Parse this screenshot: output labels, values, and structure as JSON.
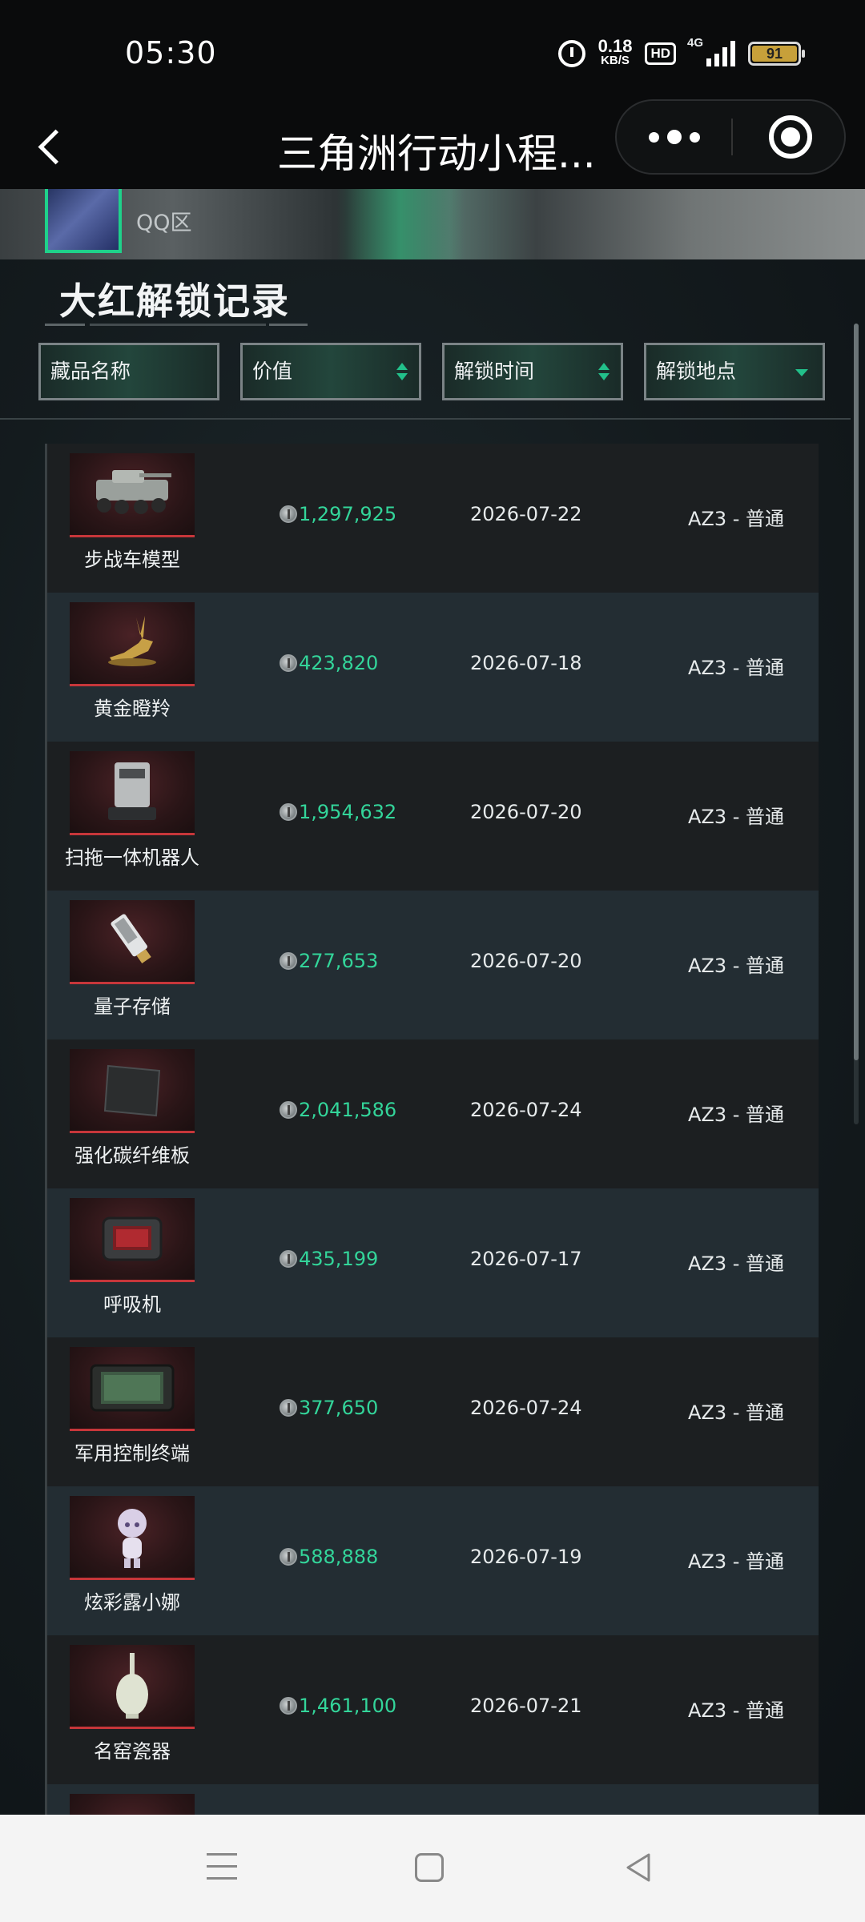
{
  "status_bar": {
    "time": "05:30",
    "speed_value": "0.18",
    "speed_unit": "KB/S",
    "hd": "HD",
    "network": "4G",
    "battery": "91"
  },
  "title_bar": {
    "title": "三角洲行动小程..."
  },
  "profile": {
    "zone": "QQ区"
  },
  "section": {
    "title": "大红解锁记录"
  },
  "filters": [
    {
      "label": "藏品名称"
    },
    {
      "label": "价值"
    },
    {
      "label": "解锁时间"
    },
    {
      "label": "解锁地点"
    }
  ],
  "records": [
    {
      "name": "步战车模型",
      "value": "1,297,925",
      "date": "2026-07-22",
      "place": "AZ3 - 普通",
      "icon": "armored-vehicle-icon"
    },
    {
      "name": "黄金瞪羚",
      "value": "423,820",
      "date": "2026-07-18",
      "place": "AZ3 - 普通",
      "icon": "golden-gazelle-icon"
    },
    {
      "name": "扫拖一体机器人",
      "value": "1,954,632",
      "date": "2026-07-20",
      "place": "AZ3 - 普通",
      "icon": "mop-robot-icon"
    },
    {
      "name": "量子存储",
      "value": "277,653",
      "date": "2026-07-20",
      "place": "AZ3 - 普通",
      "icon": "quantum-storage-icon"
    },
    {
      "name": "强化碳纤维板",
      "value": "2,041,586",
      "date": "2026-07-24",
      "place": "AZ3 - 普通",
      "icon": "carbon-fiber-plate-icon"
    },
    {
      "name": "呼吸机",
      "value": "435,199",
      "date": "2026-07-17",
      "place": "AZ3 - 普通",
      "icon": "ventilator-icon"
    },
    {
      "name": "军用控制终端",
      "value": "377,650",
      "date": "2026-07-24",
      "place": "AZ3 - 普通",
      "icon": "military-terminal-icon"
    },
    {
      "name": "炫彩露小娜",
      "value": "588,888",
      "date": "2026-07-19",
      "place": "AZ3 - 普通",
      "icon": "figurine-icon"
    },
    {
      "name": "名窑瓷器",
      "value": "1,461,100",
      "date": "2026-07-21",
      "place": "AZ3 - 普通",
      "icon": "porcelain-vase-icon"
    }
  ]
}
